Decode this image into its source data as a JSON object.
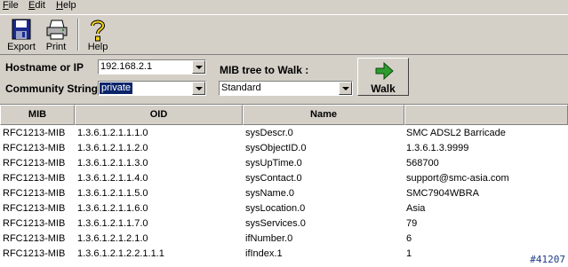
{
  "menu": {
    "items": [
      {
        "label": "File",
        "accel": "F",
        "rest": "ile"
      },
      {
        "label": "Edit",
        "accel": "E",
        "rest": "dit"
      },
      {
        "label": "Help",
        "accel": "H",
        "rest": "elp"
      }
    ]
  },
  "toolbar": {
    "export_label": "Export",
    "print_label": "Print",
    "help_label": "Help"
  },
  "form": {
    "hostname_label": "Hostname or IP",
    "hostname_value": "192.168.2.1",
    "community_label": "Community String",
    "community_value": "private",
    "mib_tree_label": "MIB tree to Walk :",
    "mib_tree_value": "Standard",
    "walk_label": "Walk"
  },
  "table": {
    "columns": [
      "MIB",
      "OID",
      "Name"
    ],
    "rows": [
      [
        "RFC1213-MIB",
        "1.3.6.1.2.1.1.1.0",
        "sysDescr.0",
        "SMC ADSL2 Barricade"
      ],
      [
        "RFC1213-MIB",
        "1.3.6.1.2.1.1.2.0",
        "sysObjectID.0",
        "1.3.6.1.3.9999"
      ],
      [
        "RFC1213-MIB",
        "1.3.6.1.2.1.1.3.0",
        "sysUpTime.0",
        "568700"
      ],
      [
        "RFC1213-MIB",
        "1.3.6.1.2.1.1.4.0",
        "sysContact.0",
        "support@smc-asia.com"
      ],
      [
        "RFC1213-MIB",
        "1.3.6.1.2.1.1.5.0",
        "sysName.0",
        "SMC7904WBRA"
      ],
      [
        "RFC1213-MIB",
        "1.3.6.1.2.1.1.6.0",
        "sysLocation.0",
        "Asia"
      ],
      [
        "RFC1213-MIB",
        "1.3.6.1.2.1.1.7.0",
        "sysServices.0",
        "79"
      ],
      [
        "RFC1213-MIB",
        "1.3.6.1.2.1.2.1.0",
        "ifNumber.0",
        "6"
      ],
      [
        "RFC1213-MIB",
        "1.3.6.1.2.1.2.2.1.1.1",
        "ifIndex.1",
        "1"
      ]
    ]
  },
  "watermark": "#41207",
  "colors": {
    "face": "#d4d0c8",
    "selection": "#0a246a",
    "arrow": "#2e9b2e",
    "watermark": "#1e3a8a"
  }
}
